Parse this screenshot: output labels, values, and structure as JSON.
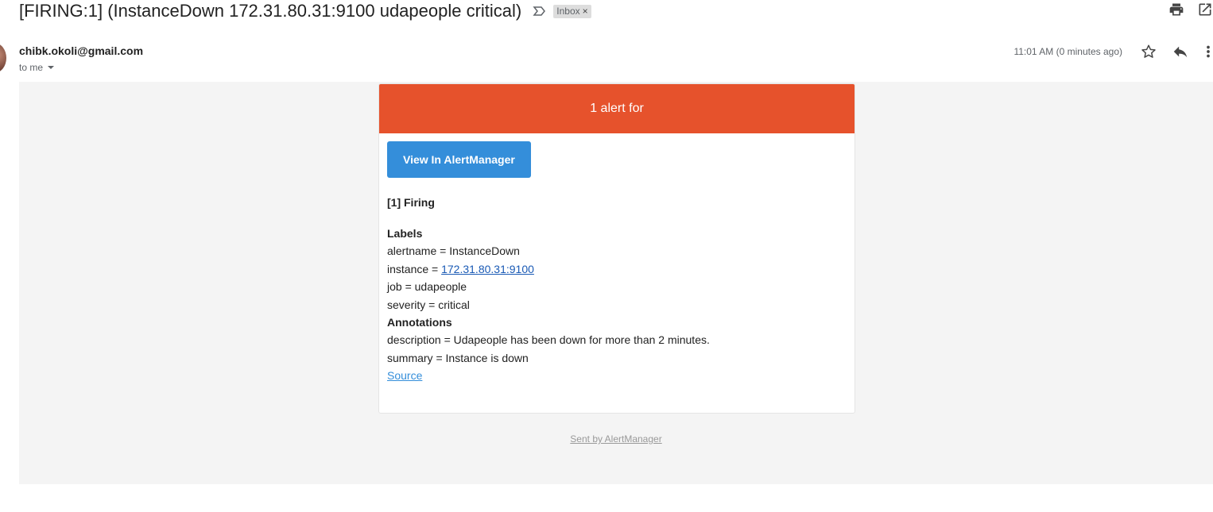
{
  "email": {
    "subject": "[FIRING:1] (InstanceDown 172.31.80.31:9100 udapeople critical)",
    "label_badge": "Inbox",
    "label_close": "×",
    "sender": "chibk.okoli@gmail.com",
    "recipient": "to me",
    "timestamp": "11:01 AM (0 minutes ago)"
  },
  "icons": {
    "important": "importance-marker-icon",
    "print": "print-icon",
    "popout": "open-in-new-window-icon",
    "star": "star-icon",
    "reply": "reply-icon",
    "more": "more-vert-icon",
    "caret": "caret-down-icon"
  },
  "alert": {
    "header": "1 alert for",
    "header_color": "#e6522c",
    "button_label": "View In AlertManager",
    "button_color": "#348eda",
    "firing_title": "[1] Firing",
    "labels_title": "Labels",
    "labels": {
      "alertname": "alertname = InstanceDown",
      "instance_prefix": "instance = ",
      "instance_link": "172.31.80.31:9100",
      "job": "job = udapeople",
      "severity": "severity = critical"
    },
    "annotations_title": "Annotations",
    "annotations": {
      "description": "description = Udapeople has been down for more than 2 minutes.",
      "summary": "summary = Instance is down"
    },
    "source_link": "Source",
    "footer": "Sent by AlertManager"
  }
}
